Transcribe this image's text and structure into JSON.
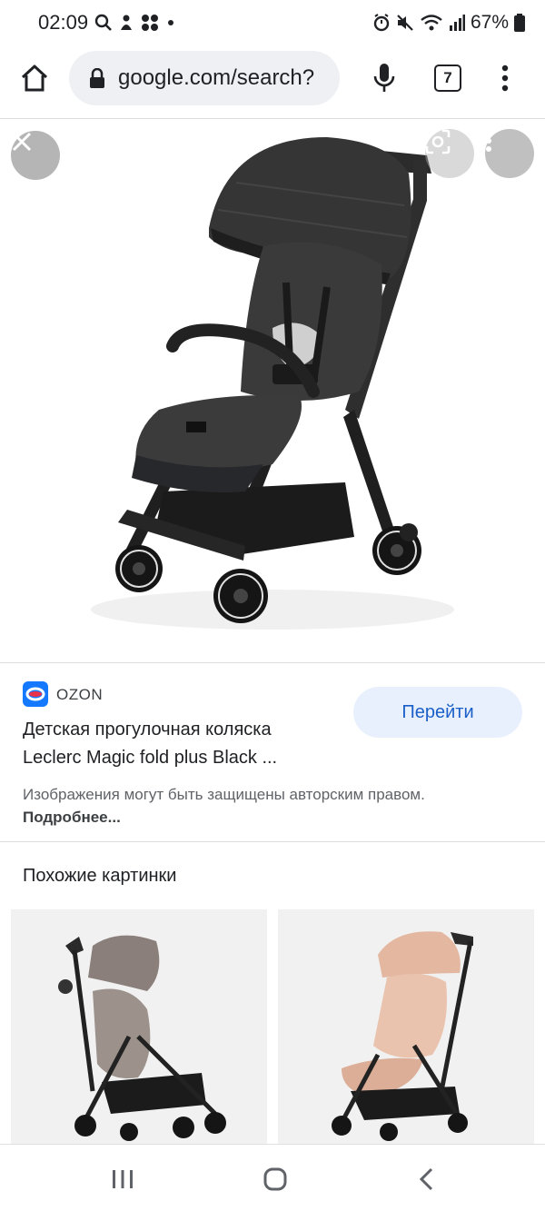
{
  "status_bar": {
    "time": "02:09",
    "battery_percent": "67%",
    "icons_left": [
      "search-icon",
      "notification-icon",
      "dots-icon"
    ],
    "icons_right": [
      "alarm-icon",
      "mute-icon",
      "wifi-icon",
      "signal-icon",
      "battery-icon"
    ]
  },
  "browser": {
    "url": "google.com/search?",
    "tab_count": "7"
  },
  "viewer": {
    "image_description_icons": [
      "close-icon",
      "lens-icon",
      "more-vert-icon"
    ]
  },
  "result": {
    "source_name": "OZON",
    "goto_label": "Перейти",
    "title_line1": "Детская прогулочная коляска",
    "title_line2": "Leclerc Magic fold plus Black ...",
    "copyright_text": "Изображения могут быть защищены авторским правом.",
    "more_link": "Подробнее..."
  },
  "similar": {
    "heading": "Похожие картинки",
    "accent_colors": [
      "#8a7f7a",
      "#e4b7a0"
    ]
  },
  "colors": {
    "accent": "#1a5fc8",
    "button_bg": "#e8f0fd"
  }
}
